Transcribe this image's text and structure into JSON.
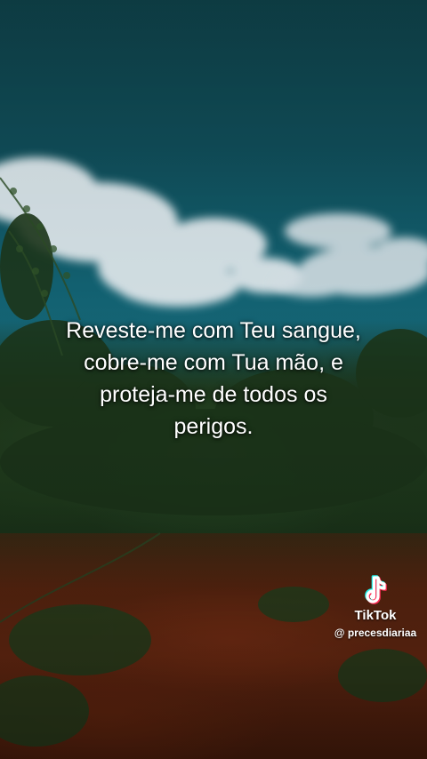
{
  "caption": {
    "lines": [
      "Reveste-me com Teu sangue,",
      "cobre-me com Tua mão, e",
      "proteja-me de todos os",
      "perigos."
    ]
  },
  "watermark": {
    "brand": "TikTok",
    "handle": "@ precesdiariaa",
    "icon": "tiktok-logo-icon"
  },
  "colors": {
    "sky": "#0f4a55",
    "cloud": "#dfe7ea",
    "foliage": "#1e3a1c",
    "soil": "#6b2a12",
    "text": "#ffffff"
  }
}
